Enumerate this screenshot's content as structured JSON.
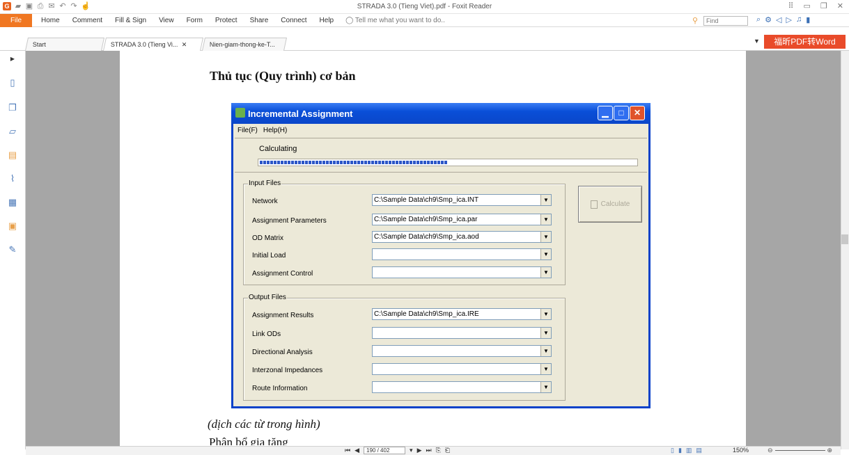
{
  "window": {
    "title": "STRADA 3.0 (Tieng Viet).pdf - Foxit Reader"
  },
  "ribbon": {
    "file": "File",
    "menus": [
      "Home",
      "Comment",
      "Fill & Sign",
      "View",
      "Form",
      "Protect",
      "Share",
      "Connect",
      "Help"
    ],
    "tell_me": "Tell me what you want to do..",
    "find_placeholder": "Find"
  },
  "tabs": [
    "Start",
    "STRADA 3.0 (Tieng Vi...",
    "Nien-giam-thong-ke-T..."
  ],
  "promo": "福昕PDF转Word",
  "document": {
    "heading": "Thủ tục (Quy trình) cơ bản",
    "caption": "(dịch các từ trong hình)",
    "next_line": "Phân bổ gia tăng"
  },
  "dialog": {
    "title": "Incremental Assignment",
    "menu": [
      "File(F)",
      "Help(H)"
    ],
    "status": "Calculating",
    "progress": 0.5,
    "input_group": "Input Files",
    "inputs": [
      {
        "label": "Network",
        "value": "C:\\Sample Data\\ch9\\Smp_ica.INT"
      },
      {
        "label": "Assignment Parameters",
        "value": "C:\\Sample Data\\ch9\\Smp_ica.par"
      },
      {
        "label": "OD Matrix",
        "value": "C:\\Sample Data\\ch9\\Smp_ica.aod"
      },
      {
        "label": "Initial Load",
        "value": ""
      },
      {
        "label": "Assignment Control",
        "value": ""
      }
    ],
    "output_group": "Output Files",
    "outputs": [
      {
        "label": "Assignment Results",
        "value": "C:\\Sample Data\\ch9\\Smp_ica.IRE"
      },
      {
        "label": "Link ODs",
        "value": ""
      },
      {
        "label": "Directional Analysis",
        "value": ""
      },
      {
        "label": "Interzonal Impedances",
        "value": ""
      },
      {
        "label": "Route Information",
        "value": ""
      }
    ],
    "calculate": "Calculate"
  },
  "statusbar": {
    "page": "190 / 402",
    "zoom": "150%"
  }
}
